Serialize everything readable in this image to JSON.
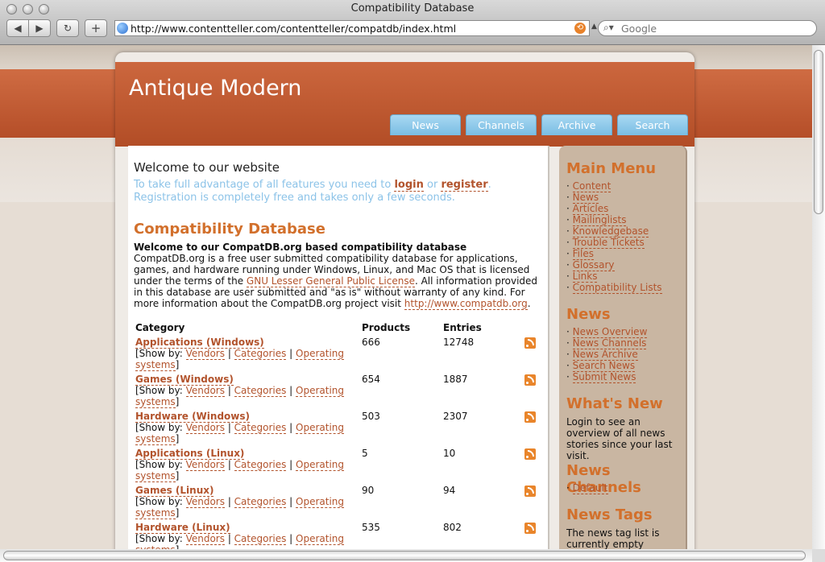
{
  "window": {
    "title": "Compatibility Database"
  },
  "toolbar": {
    "back_glyph": "◀",
    "forward_glyph": "▶",
    "reload_glyph": "↻",
    "add_glyph": "+"
  },
  "address": {
    "url": "http://www.contentteller.com/contentteller/compatdb/index.html"
  },
  "search": {
    "placeholder": "Google"
  },
  "site": {
    "title": "Antique Modern",
    "tabs": [
      {
        "label": "News"
      },
      {
        "label": "Channels"
      },
      {
        "label": "Archive"
      },
      {
        "label": "Search"
      }
    ]
  },
  "welcome": {
    "title": "Welcome to our website",
    "text_before": "To take full advantage of all features you need to ",
    "login": "login",
    "or": " or ",
    "register": "register",
    "text_after": ". Registration is completely free and takes only a few seconds."
  },
  "db": {
    "title": "Compatibility Database",
    "intro_title": "Welcome to our CompatDB.org based compatibility database",
    "intro_p1": "CompatDB.org is a free user submitted compatibility database for applications, games, and hardware running under Windows, Linux, and Mac OS that is licensed under the terms of the ",
    "license_link": "GNU Lesser General Public License",
    "intro_p2": ". All information provided in this database are user submitted and \"as is\" without warranty of any kind. For more information about the CompatDB.org project visit ",
    "site_link": "http://www.compatdb.org",
    "intro_p3": ".",
    "columns": {
      "category": "Category",
      "products": "Products",
      "entries": "Entries"
    },
    "show_by": "[Show by: ",
    "vendors": "Vendors",
    "sep": " | ",
    "categories": "Categories",
    "operating": "Operating",
    "systems": "systems",
    "close_bracket": "]",
    "rows": [
      {
        "name": "Applications (Windows)",
        "products": "666",
        "entries": "12748"
      },
      {
        "name": "Games (Windows)",
        "products": "654",
        "entries": "1887"
      },
      {
        "name": "Hardware (Windows)",
        "products": "503",
        "entries": "2307"
      },
      {
        "name": "Applications (Linux)",
        "products": "5",
        "entries": "10"
      },
      {
        "name": "Games (Linux)",
        "products": "90",
        "entries": "94"
      },
      {
        "name": "Hardware (Linux)",
        "products": "535",
        "entries": "802"
      }
    ]
  },
  "sidebar": {
    "main_menu": {
      "title": "Main Menu",
      "items": [
        "Content",
        "News",
        "Articles",
        "Mailinglists",
        "Knowledgebase",
        "Trouble Tickets",
        "Files",
        "Glossary",
        "Links",
        "Compatibility Lists"
      ]
    },
    "news": {
      "title": "News",
      "items": [
        "News Overview",
        "News Channels",
        "News Archive",
        "Search News",
        "Submit News"
      ]
    },
    "whats_new": {
      "title": "What's New",
      "text": "Login to see an overview of all news stories since your last visit."
    },
    "news_channels": {
      "title": "News Channels",
      "items": [
        "Default"
      ]
    },
    "news_tags": {
      "title": "News Tags",
      "text": "The news tag list is currently empty"
    }
  },
  "colors": {
    "accent": "#c45d33",
    "link": "#b2532c",
    "heading": "#d2702c",
    "tab": "#8ecbea",
    "welcome_text": "#8cc3e8"
  }
}
